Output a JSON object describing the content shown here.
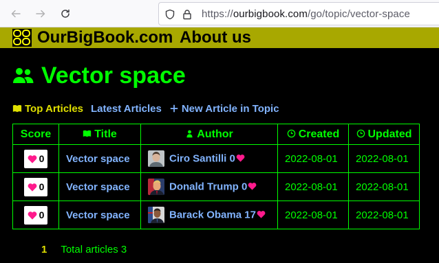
{
  "browser": {
    "url_prefix": "https://",
    "url_host": "ourbigbook.com",
    "url_path": "/go/topic/vector-space"
  },
  "site": {
    "logo_name": "OurBigBook logo",
    "name": "OurBigBook.com",
    "about": "About us",
    "header_color": "#a8a800"
  },
  "page": {
    "title": "Vector space",
    "title_icon": "users-icon",
    "title_color": "#00ff00"
  },
  "tabs": [
    {
      "label": "Top Articles",
      "icon": "book-icon",
      "active": true
    },
    {
      "label": "Latest Articles",
      "active": false
    },
    {
      "label": "New Article in Topic",
      "icon": "plus-icon",
      "active": false
    }
  ],
  "table": {
    "headers": {
      "score": "Score",
      "title": "Title",
      "author": "Author",
      "created": "Created",
      "updated": "Updated"
    },
    "rows": [
      {
        "score": "0",
        "title": "Vector space",
        "author": "Ciro Santilli",
        "author_score": "0",
        "created": "2022-08-01",
        "updated": "2022-08-01"
      },
      {
        "score": "0",
        "title": "Vector space",
        "author": "Donald Trump",
        "author_score": "0",
        "created": "2022-08-01",
        "updated": "2022-08-01"
      },
      {
        "score": "0",
        "title": "Vector space",
        "author": "Barack Obama",
        "author_score": "17",
        "created": "2022-08-01",
        "updated": "2022-08-01"
      }
    ]
  },
  "pagination": {
    "current_page": "1",
    "total": "Total articles 3"
  },
  "colors": {
    "accent_green": "#00ff00",
    "link_blue": "#82b4ff",
    "yellow": "#e0e000",
    "heart": "#ff1a8c"
  }
}
